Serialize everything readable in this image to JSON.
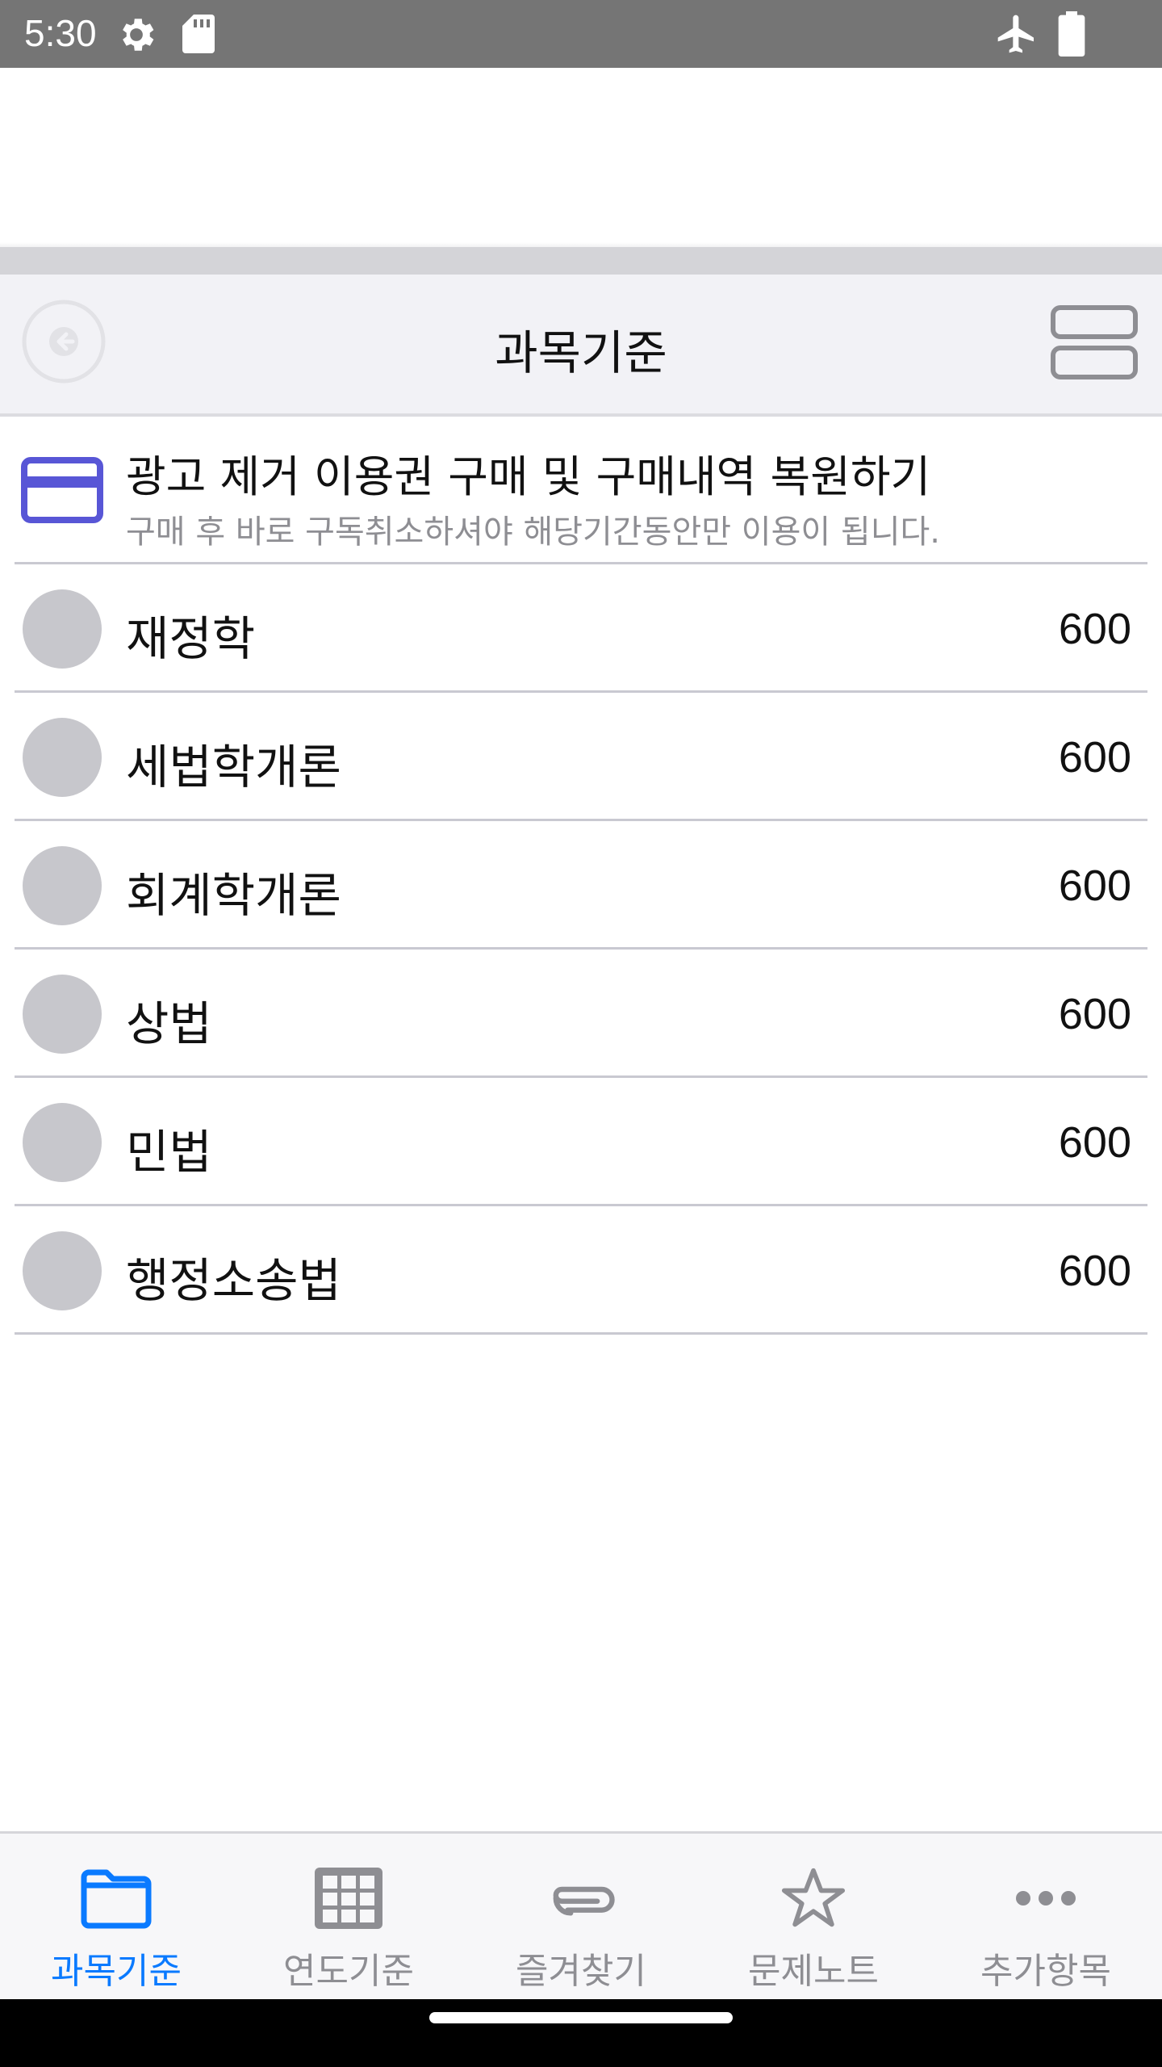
{
  "status_bar": {
    "time": "5:30",
    "icons": [
      "settings-gear-icon",
      "sd-card-icon",
      "airplane-mode-icon",
      "battery-icon"
    ]
  },
  "nav": {
    "title": "과목기준",
    "back_icon": "back-arrow-icon",
    "layout_icon": "layout-toggle-icon"
  },
  "promo": {
    "icon": "credit-card-icon",
    "title": "광고 제거 이용권 구매 및 구매내역 복원하기",
    "subtitle": "구매 후 바로 구독취소하셔야 해당기간동안만 이용이 됩니다.",
    "accent_color": "#5856d6"
  },
  "subjects": [
    {
      "name": "재정학",
      "count": "600"
    },
    {
      "name": "세법학개론",
      "count": "600"
    },
    {
      "name": "회계학개론",
      "count": "600"
    },
    {
      "name": "상법",
      "count": "600"
    },
    {
      "name": "민법",
      "count": "600"
    },
    {
      "name": "행정소송법",
      "count": "600"
    }
  ],
  "tabs": [
    {
      "label": "과목기준",
      "icon": "folder-icon",
      "active": true
    },
    {
      "label": "연도기준",
      "icon": "grid-icon",
      "active": false
    },
    {
      "label": "즐겨찾기",
      "icon": "paperclip-icon",
      "active": false
    },
    {
      "label": "문제노트",
      "icon": "star-icon",
      "active": false
    },
    {
      "label": "추가항목",
      "icon": "more-icon",
      "active": false
    }
  ],
  "colors": {
    "active_tab": "#0a7aff",
    "inactive_tab": "#8e8e93",
    "status_bar": "#757575"
  }
}
